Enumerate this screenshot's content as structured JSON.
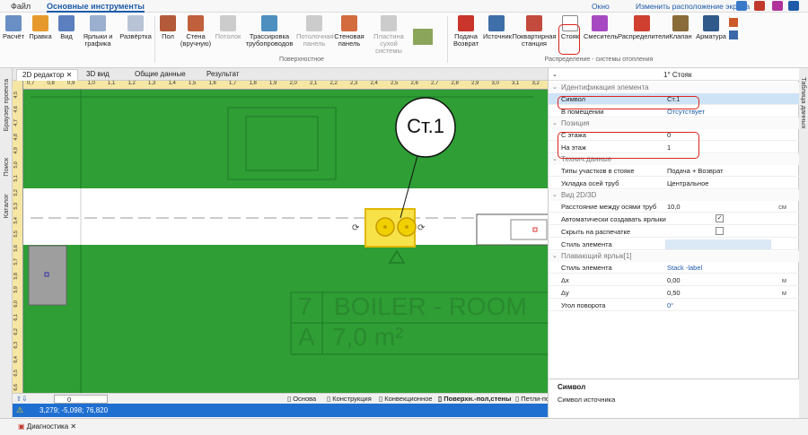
{
  "menubar": {
    "tabs": [
      {
        "label": "Файл",
        "active": false
      },
      {
        "label": "Основные инструменты",
        "active": true
      }
    ],
    "right_links": [
      "Окно",
      "Изменить расположение экрана"
    ]
  },
  "ribbon": {
    "tools": [
      {
        "label": "Расчёт",
        "icon": "calculate-icon"
      },
      {
        "label": "Правка",
        "icon": "edit-icon"
      },
      {
        "label": "Вид",
        "icon": "view-icon"
      },
      {
        "label": "Ярлыки и графика",
        "icon": "labels-icon"
      },
      {
        "label": "Развёртка",
        "icon": "unfold-icon"
      },
      {
        "label": "Пол",
        "icon": "floor-icon"
      },
      {
        "label": "Стена (вручную)",
        "icon": "wall-icon"
      },
      {
        "label": "Потолок",
        "icon": "ceiling-icon"
      },
      {
        "label": "Трассировка трубопроводов",
        "icon": "piping-icon"
      },
      {
        "label": "Потолочная панель",
        "icon": "ceiling-panel-icon"
      },
      {
        "label": "Стеновая панель",
        "icon": "wall-panel-icon"
      },
      {
        "label": "Пластина сухой системы",
        "icon": "dry-plate-icon"
      },
      {
        "label": "Подача Возврат",
        "icon": "supply-return-icon"
      },
      {
        "label": "Источник",
        "icon": "source-icon"
      },
      {
        "label": "Поквартирная станция",
        "icon": "apartment-station-icon"
      },
      {
        "label": "Стояк",
        "icon": "riser-icon"
      },
      {
        "label": "Смеситель",
        "icon": "mixer-icon"
      },
      {
        "label": "Распределители",
        "icon": "distributors-icon"
      },
      {
        "label": "Клапан",
        "icon": "valve-icon"
      },
      {
        "label": "Арматура",
        "icon": "fittings-icon"
      }
    ],
    "groups": [
      "Поверхностное",
      "Распределение - системы отопления"
    ]
  },
  "view_tabs": [
    "2D редактор",
    "3D вид",
    "Общие данные",
    "Результат"
  ],
  "left_sidebar": [
    "Браузер проекта",
    "Поиск",
    "Каталог"
  ],
  "right_sidebar": [
    "Таблица данных"
  ],
  "ruler": {
    "h_ticks": [
      "0,7",
      "0,8",
      "0,9",
      "1,0",
      "1,1",
      "1,2",
      "1,3",
      "1,4",
      "1,5",
      "1,6",
      "1,7",
      "1,8",
      "1,9",
      "2,0",
      "2,1",
      "2,2",
      "2,3",
      "2,4",
      "2,5",
      "2,6",
      "2,7",
      "2,8",
      "2,9",
      "3,0",
      "3,1",
      "3,2"
    ],
    "v_ticks": [
      "4,5",
      "4,6",
      "4,7",
      "4,8",
      "4,9",
      "5,0",
      "5,1",
      "5,2",
      "5,3",
      "5,4",
      "5,5",
      "5,6",
      "5,7",
      "5,8",
      "5,9",
      "6,0",
      "6,1",
      "6,2",
      "6,3",
      "6,4",
      "6,5",
      "6,6"
    ]
  },
  "canvas": {
    "callout": "Ст.1",
    "room_number": "7",
    "room_name": "BOILER - ROOM",
    "area_letter": "A",
    "area_value": "7,0 m²",
    "colors": {
      "green": "#2e9e35",
      "corridor": "#ffffff",
      "highlight": "#f0d000",
      "selection": "#f7e24a"
    }
  },
  "layers": [
    "Основа",
    "Конструкция",
    "Конвекционное",
    "Поверхн.-пол,стены",
    "Петли-пол"
  ],
  "layer_select": "0",
  "status": {
    "coords": "3,279; -5,098; 76,820"
  },
  "bottom_tab": "Диагностика",
  "properties": {
    "header_title": "1° Стояк",
    "sections": [
      {
        "title": "Идентификация элемента",
        "rows": [
          {
            "key": "Символ",
            "value": "Ст.1"
          },
          {
            "key": "В помещении",
            "value": "Отсутствует"
          }
        ]
      },
      {
        "title": "Позиция",
        "rows": [
          {
            "key": "С этажа",
            "value": "0"
          },
          {
            "key": "На этаж",
            "value": "1"
          }
        ]
      },
      {
        "title": "Технич.данные",
        "rows": [
          {
            "key": "Типы участков в стояке",
            "value": "Подача + Возврат"
          },
          {
            "key": "Укладка осей труб",
            "value": "Центральное"
          }
        ]
      },
      {
        "title": "Вид 2D/3D",
        "rows": [
          {
            "key": "Расстояние между осями труб",
            "value": "10,0",
            "unit": "см"
          },
          {
            "key": "Автоматически создавать ярлыки",
            "value": "✓"
          },
          {
            "key": "Скрыть на распечатке",
            "value": ""
          },
          {
            "key": "Стиль элемента",
            "value": ""
          }
        ]
      },
      {
        "title": "Плавающий ярлык[1]",
        "rows": [
          {
            "key": "Стиль элемента",
            "value": "Stack -label"
          },
          {
            "key": "Δx",
            "value": "0,00",
            "unit": "м"
          },
          {
            "key": "Δy",
            "value": "0,50",
            "unit": "м"
          },
          {
            "key": "Угол поворота",
            "value": "0°"
          }
        ]
      }
    ],
    "description_title": "Символ",
    "description_text": "Символ источника"
  }
}
